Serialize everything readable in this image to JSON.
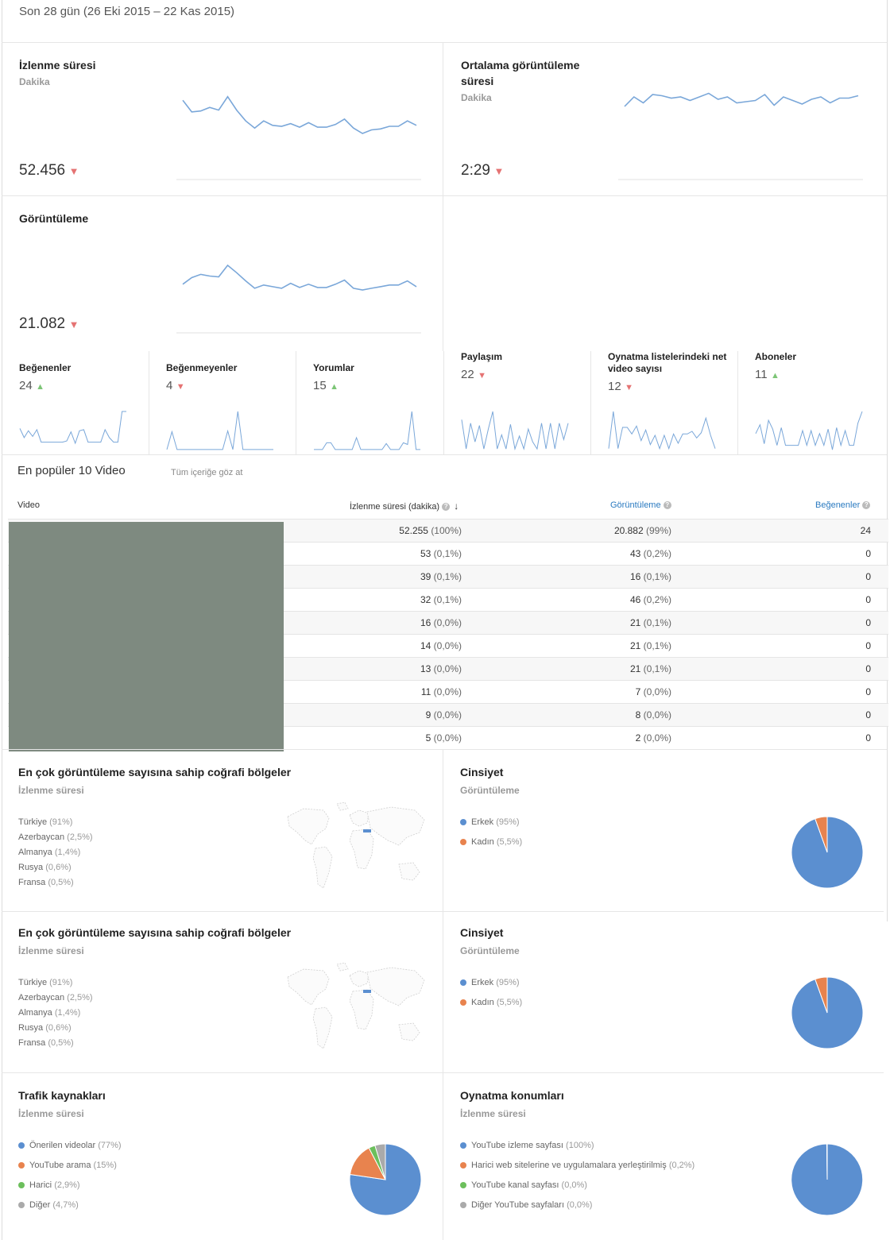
{
  "header": {
    "date_range": "Son 28 gün (26 Eki 2015 – 22 Kas 2015)"
  },
  "colors": {
    "line": "#7aa7d9",
    "down": "#e57373",
    "up": "#7cc576",
    "blue": "#5b8fd0",
    "orange": "#e8834e",
    "green": "#6cbf5c",
    "gray": "#aaaaaa"
  },
  "metrics": {
    "watch_time": {
      "title": "İzlenme süresi",
      "sub": "Dakika",
      "value": "52.456",
      "trend": "▼",
      "spark": [
        9,
        22,
        21,
        17,
        20,
        5,
        20,
        32,
        40,
        32,
        37,
        38,
        35,
        39,
        34,
        39,
        39,
        36,
        30,
        40,
        46,
        42,
        41,
        38,
        38,
        32,
        37
      ]
    },
    "avg_view": {
      "title": "Ortalama görüntüleme süresi",
      "sub": "Dakika",
      "value": "2:29",
      "trend": "▼",
      "spark": [
        12,
        4,
        9,
        2,
        3,
        5,
        4,
        7,
        4,
        1,
        6,
        4,
        9,
        8,
        7,
        2,
        11,
        4,
        7,
        10,
        6,
        4,
        9,
        5,
        5,
        3
      ]
    },
    "views": {
      "title": "Görüntüleme",
      "value": "21.082",
      "trend": "▼",
      "spark": [
        24,
        16,
        12,
        14,
        15,
        1,
        10,
        20,
        29,
        25,
        27,
        29,
        23,
        28,
        24,
        28,
        28,
        24,
        19,
        29,
        31,
        29,
        27,
        25,
        25,
        20,
        27
      ]
    }
  },
  "small_metrics": [
    {
      "title": "Beğenenler",
      "value": "24",
      "trend": "▲",
      "spark": [
        20,
        12,
        18,
        13,
        19,
        8,
        8,
        8,
        8,
        8,
        8,
        9,
        17,
        7,
        18,
        19,
        8,
        8,
        8,
        8,
        19,
        12,
        8,
        8,
        35,
        35
      ]
    },
    {
      "title": "Beğenmeyenler",
      "value": "4",
      "trend": "▼",
      "spark": [
        2,
        23,
        2,
        2,
        2,
        2,
        2,
        2,
        2,
        2,
        2,
        2,
        24,
        2,
        47,
        2,
        2,
        2,
        2,
        2,
        2,
        2
      ]
    },
    {
      "title": "Yorumlar",
      "value": "15",
      "trend": "▲",
      "spark": [
        2,
        2,
        2,
        10,
        10,
        2,
        2,
        2,
        2,
        2,
        16,
        2,
        2,
        2,
        2,
        2,
        2,
        9,
        2,
        2,
        2,
        10,
        8,
        47,
        2,
        2
      ]
    },
    {
      "title": "Paylaşım",
      "value": "22",
      "trend": "▼",
      "spark": [
        27,
        2,
        24,
        8,
        22,
        2,
        19,
        34,
        2,
        14,
        2,
        23,
        2,
        13,
        2,
        19,
        8,
        2,
        24,
        2,
        24,
        2,
        24,
        10,
        24
      ]
    },
    {
      "title": "Oynatma listelerindeki net video sayısı",
      "value": "12",
      "trend": "▼",
      "spark": [
        2,
        30,
        2,
        18,
        18,
        13,
        19,
        8,
        16,
        5,
        12,
        2,
        12,
        2,
        13,
        6,
        13,
        13,
        15,
        10,
        14,
        25,
        12,
        2
      ]
    },
    {
      "title": "Aboneler",
      "value": "11",
      "trend": "▲",
      "spark": [
        12,
        18,
        5,
        21,
        15,
        4,
        16,
        4,
        4,
        4,
        4,
        14,
        4,
        14,
        4,
        12,
        4,
        15,
        1,
        16,
        4,
        14,
        4,
        4,
        19,
        27
      ]
    }
  ],
  "top_videos": {
    "title": "En popüler 10 Video",
    "link": "Tüm içeriğe göz at",
    "col_video": "Video",
    "col_watch": "İzlenme süresi (dakika)",
    "col_views": "Görüntüleme",
    "col_likes": "Beğenenler",
    "rows": [
      {
        "watch": "52.255",
        "watch_pct": "(100%)",
        "views": "20.882",
        "views_pct": "(99%)",
        "likes": "24"
      },
      {
        "watch": "53",
        "watch_pct": "(0,1%)",
        "views": "43",
        "views_pct": "(0,2%)",
        "likes": "0"
      },
      {
        "watch": "39",
        "watch_pct": "(0,1%)",
        "views": "16",
        "views_pct": "(0,1%)",
        "likes": "0"
      },
      {
        "watch": "32",
        "watch_pct": "(0,1%)",
        "views": "46",
        "views_pct": "(0,2%)",
        "likes": "0"
      },
      {
        "watch": "16",
        "watch_pct": "(0,0%)",
        "views": "21",
        "views_pct": "(0,1%)",
        "likes": "0"
      },
      {
        "watch": "14",
        "watch_pct": "(0,0%)",
        "views": "21",
        "views_pct": "(0,1%)",
        "likes": "0"
      },
      {
        "watch": "13",
        "watch_pct": "(0,0%)",
        "views": "21",
        "views_pct": "(0,1%)",
        "likes": "0"
      },
      {
        "watch": "11",
        "watch_pct": "(0,0%)",
        "views": "7",
        "views_pct": "(0,0%)",
        "likes": "0"
      },
      {
        "watch": "9",
        "watch_pct": "(0,0%)",
        "views": "8",
        "views_pct": "(0,0%)",
        "likes": "0"
      },
      {
        "watch": "5",
        "watch_pct": "(0,0%)",
        "views": "2",
        "views_pct": "(0,0%)",
        "likes": "0"
      }
    ]
  },
  "geo": {
    "title": "En çok görüntüleme sayısına sahip coğrafi bölgeler",
    "sub": "İzlenme süresi",
    "items": [
      {
        "name": "Türkiye",
        "pct": "(91%)"
      },
      {
        "name": "Azerbaycan",
        "pct": "(2,5%)"
      },
      {
        "name": "Almanya",
        "pct": "(1,4%)"
      },
      {
        "name": "Rusya",
        "pct": "(0,6%)"
      },
      {
        "name": "Fransa",
        "pct": "(0,5%)"
      }
    ]
  },
  "gender": {
    "title": "Cinsiyet",
    "sub": "Görüntüleme",
    "items": [
      {
        "name": "Erkek",
        "pct": "(95%)",
        "value": 94.5,
        "color": "#5b8fd0"
      },
      {
        "name": "Kadın",
        "pct": "(5,5%)",
        "value": 5.5,
        "color": "#e8834e"
      }
    ]
  },
  "traffic": {
    "title": "Trafik kaynakları",
    "sub": "İzlenme süresi",
    "items": [
      {
        "name": "Önerilen videolar",
        "pct": "(77%)",
        "value": 77,
        "color": "#5b8fd0"
      },
      {
        "name": "YouTube arama",
        "pct": "(15%)",
        "value": 15,
        "color": "#e8834e"
      },
      {
        "name": "Harici",
        "pct": "(2,9%)",
        "value": 2.9,
        "color": "#6cbf5c"
      },
      {
        "name": "Diğer",
        "pct": "(4,7%)",
        "value": 4.7,
        "color": "#aaaaaa"
      }
    ]
  },
  "playback": {
    "title": "Oynatma konumları",
    "sub": "İzlenme süresi",
    "items": [
      {
        "name": "YouTube izleme sayfası",
        "pct": "(100%)",
        "value": 99.8,
        "color": "#5b8fd0"
      },
      {
        "name": "Harici web sitelerine ve uygulamalara yerleştirilmiş",
        "pct": "(0,2%)",
        "value": 0.2,
        "color": "#e8834e"
      },
      {
        "name": "YouTube kanal sayfası",
        "pct": "(0,0%)",
        "value": 0,
        "color": "#6cbf5c"
      },
      {
        "name": "Diğer YouTube sayfaları",
        "pct": "(0,0%)",
        "value": 0,
        "color": "#aaaaaa"
      }
    ]
  }
}
